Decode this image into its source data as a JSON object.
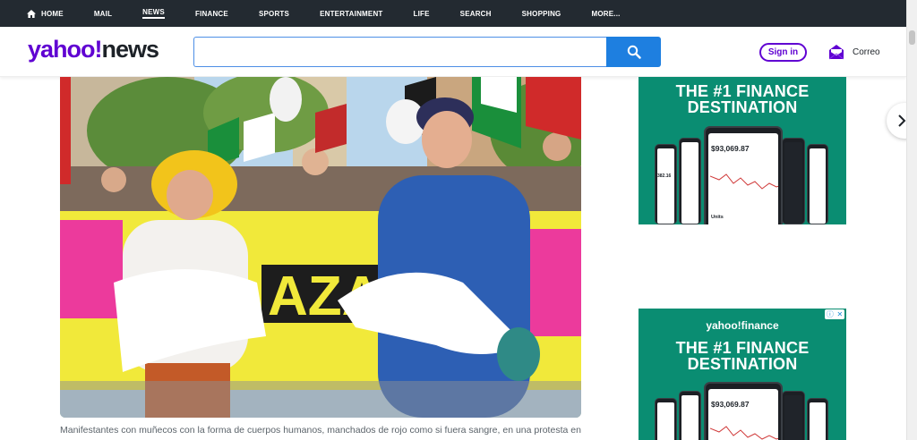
{
  "nav": {
    "items": [
      "HOME",
      "MAIL",
      "NEWS",
      "FINANCE",
      "SPORTS",
      "ENTERTAINMENT",
      "LIFE",
      "SEARCH",
      "SHOPPING",
      "MORE..."
    ],
    "active": "NEWS"
  },
  "header": {
    "logo_brand": "yahoo!",
    "logo_section": "news",
    "search_placeholder": "",
    "signin_label": "Sign in",
    "mail_label": "Correo"
  },
  "article": {
    "caption": "Manifestantes con muñecos con la forma de cuerpos humanos, manchados de rojo como si fuera sangre, en una protesta en"
  },
  "photo_banner_text": "AZA",
  "ads": [
    {
      "headline_line1": "THE #1 FINANCE",
      "headline_line2": "DESTINATION",
      "phone_value": "$93,069.87",
      "left_phone_value": "382.16",
      "phone_tab_label": "Units"
    },
    {
      "brand": "yahoo!finance",
      "headline_line1": "THE #1 FINANCE",
      "headline_line2": "DESTINATION",
      "phone_value": "$93,069.87"
    }
  ],
  "colors": {
    "brand_purple": "#6001d2",
    "nav_bg": "#232a31",
    "search_blue": "#1e7fe0",
    "ad_green": "#0a8d72"
  },
  "icons": {
    "home": "home-icon",
    "search": "search-icon",
    "mail": "mail-icon",
    "next": "chevron-right-icon",
    "adchoices": "adchoices-icon"
  }
}
